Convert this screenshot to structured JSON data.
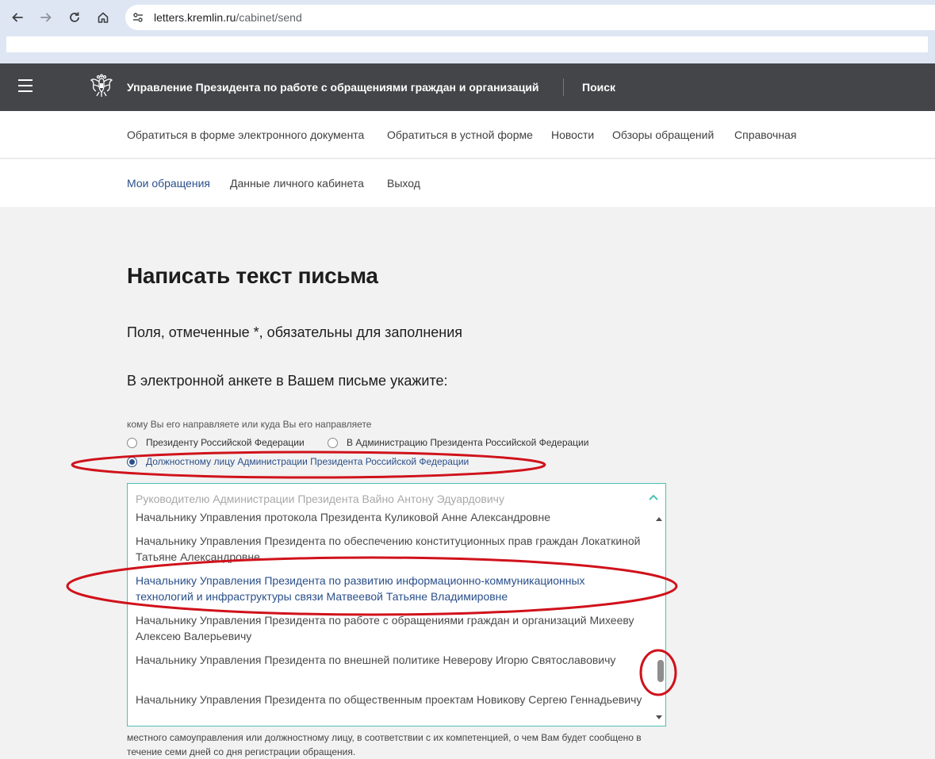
{
  "browser": {
    "url_host": "letters.kremlin.ru",
    "url_path": "/cabinet/send"
  },
  "header": {
    "title": "Управление Президента по работе с обращениями граждан и организаций",
    "search": "Поиск"
  },
  "topnav": {
    "items": [
      "Обратиться в форме электронного документа",
      "Обратиться в устной форме",
      "Новости",
      "Обзоры обращений",
      "Справочная"
    ]
  },
  "subnav": {
    "items": [
      "Мои обращения",
      "Данные личного кабинета",
      "Выход"
    ],
    "active_index": 0
  },
  "main": {
    "title": "Написать текст письма",
    "required_note": "Поля, отмеченные *, обязательны для заполнения",
    "instruction": "В электронной анкете в Вашем письме укажите:",
    "recipient_label": "кому Вы его направляете или куда Вы его направляете",
    "recipient_options": [
      {
        "label": "Президенту Российской Федерации",
        "selected": false
      },
      {
        "label": "В Администрацию Президента Российской Федерации",
        "selected": false
      },
      {
        "label": "Должностному лицу Администрации Президента Российской Федерации",
        "selected": true
      }
    ],
    "official_select": {
      "selected_value": "Руководителю Администрации Президента Вайно Антону Эдуардовичу",
      "options": [
        "Начальнику Управления протокола Президента Куликовой Анне Александровне",
        "Начальнику Управления Президента по обеспечению конституционных прав граждан Локаткиной Татьяне Александровне",
        "Начальнику Управления Президента по развитию информационно-коммуникационных технологий и инфраструктуры связи Матвеевой Татьяне Владимировне",
        "Начальнику Управления Президента по работе с обращениями граждан и организаций Михееву Алексею Валерьевичу",
        "Начальнику Управления Президента по внешней политике Неверову Игорю Святославовичу",
        "Начальнику Управления Президента по общественным проектам Новикову Сергею Геннадьевичу"
      ],
      "highlighted_index": 2
    },
    "after_text": "местного самоуправления или должностному лицу, в соответствии с их компетенцией, о чем Вам будет сообщено в течение семи дней со дня регистрации обращения."
  },
  "colors": {
    "header_bg": "#434548",
    "accent_blue": "#2a4f8a",
    "select_border": "#4ec1b4",
    "annotation_red": "#d0121b"
  }
}
